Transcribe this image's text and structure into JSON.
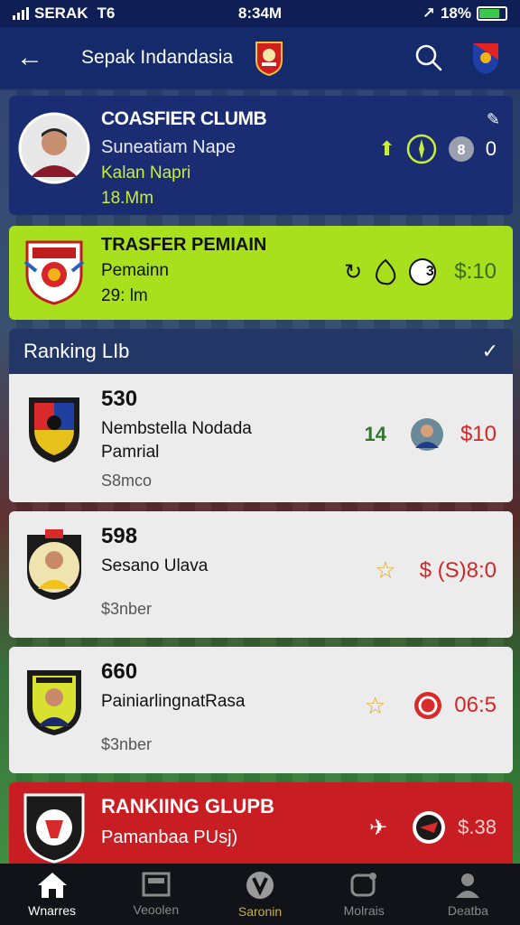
{
  "status_bar": {
    "carrier": "SERAK",
    "network": "T6",
    "time": "8:34M",
    "battery": "18%"
  },
  "header": {
    "title": "Sepak Indandasia"
  },
  "cards": [
    {
      "title": "COASFIER CLUMB",
      "line1": "Suneatiam Nape",
      "line2": "Kalan Napri",
      "line3": "18.Mm",
      "stat": "0"
    },
    {
      "title": "TRASFER PEMIAIN",
      "line1": "Pemainn",
      "line2": "29: lm",
      "badge": "3",
      "value": "$:10"
    }
  ],
  "ranking": {
    "label": "Ranking LIb",
    "items": [
      {
        "num": "530",
        "name": "Nembstella Nodada",
        "name2": "Pamrial",
        "price": "S8mco",
        "badge": "14",
        "value": "$10"
      },
      {
        "num": "598",
        "name": "Sesano Ulava",
        "name2": "",
        "price": "$3nber",
        "value": "$ (S)8:0"
      },
      {
        "num": "660",
        "name": "PainiarlingnatRasa",
        "name2": "",
        "price": "$3nber",
        "value": "06:5"
      }
    ]
  },
  "bottom_card": {
    "title": "RANKIING GLUPB",
    "sub": "Pamanbaa PUsj)",
    "value": "$.38"
  },
  "nav": [
    {
      "label": "Wnarres",
      "icon": "home-icon"
    },
    {
      "label": "Veoolen",
      "icon": "news-icon"
    },
    {
      "label": "Saronin",
      "icon": "trophy-icon"
    },
    {
      "label": "Molrais",
      "icon": "chat-icon"
    },
    {
      "label": "Deatba",
      "icon": "profile-icon"
    }
  ],
  "colors": {
    "primary": "#142a6a",
    "accent_green": "#a8e01e",
    "accent_red": "#c81d22"
  }
}
